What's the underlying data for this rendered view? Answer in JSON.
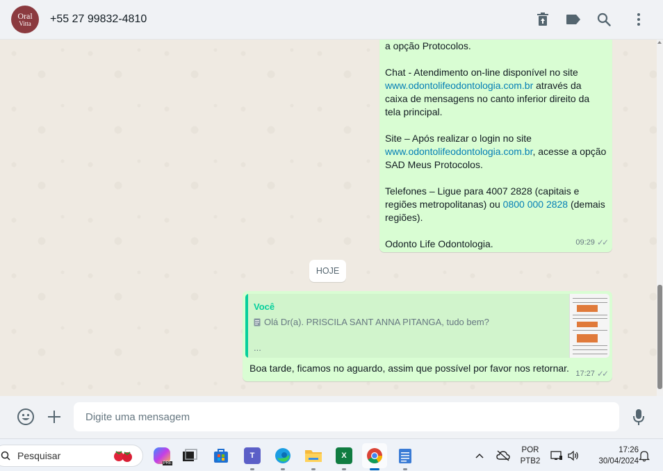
{
  "header": {
    "avatar_text_top": "Oral",
    "avatar_text_bottom": "Vitta",
    "contact": "+55 27 99832-4810",
    "icons": [
      "delete-icon",
      "label-icon",
      "search-icon",
      "menu-icon"
    ]
  },
  "chat": {
    "msg1": {
      "para1": "a opção Protocolos.",
      "para2_a": "Chat - Atendimento on-line disponível no site ",
      "para2_link": "www.odontolifeodontologia.com.br",
      "para2_b": " através da caixa de mensagens no canto inferior direito da tela principal.",
      "para3_a": "Site – Após realizar o login no site ",
      "para3_link": "www.odontolifeodontologia.com.br",
      "para3_b": ", acesse a opção SAD Meus Protocolos.",
      "para4_a": "Telefones – Ligue para 4007 2828 (capitais e regiões metropolitanas) ou ",
      "para4_link": "0800 000 2828",
      "para4_b": " (demais regiões).",
      "para5": "Odonto Life Odontologia.",
      "time": "09:29"
    },
    "date_chip": "HOJE",
    "msg2": {
      "quote_author": "Você",
      "quote_text": "Olá Dr(a). PRISCILA SANT ANNA PITANGA, tudo bem?",
      "quote_more": "...",
      "text": "Boa tarde, ficamos no aguardo, assim que possível por favor nos retornar.",
      "time": "17:27"
    }
  },
  "composer": {
    "placeholder": "Digite uma mensagem"
  },
  "taskbar": {
    "search_label": "Pesquisar",
    "lang_top": "POR",
    "lang_bottom": "PTB2",
    "clock_time": "17:26",
    "clock_date": "30/04/2024",
    "apps": [
      "copilot",
      "task-view",
      "store",
      "teams",
      "edge",
      "explorer",
      "excel",
      "chrome",
      "notepad"
    ]
  },
  "colors": {
    "bubble_out": "#d9fdd3",
    "accent": "#06cf9c",
    "link": "#027eb5",
    "chat_bg": "#efeae2"
  }
}
